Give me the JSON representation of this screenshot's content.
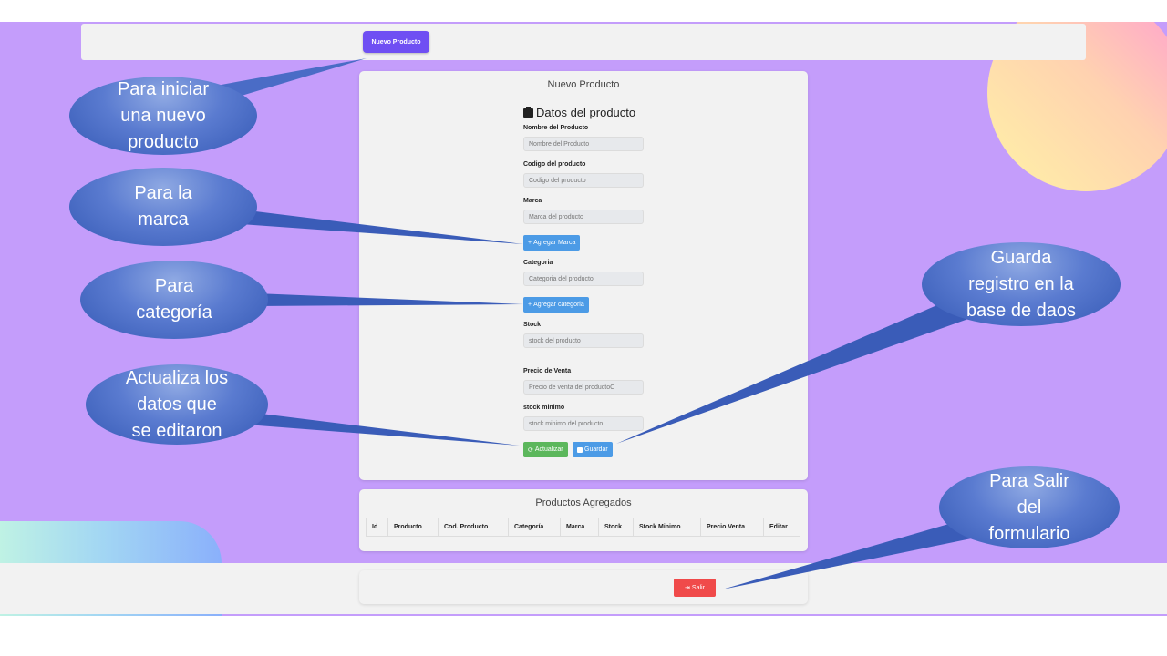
{
  "toolbar": {
    "new_product_label": "Nuevo Producto"
  },
  "form": {
    "title": "Nuevo Producto",
    "section_title": "Datos del producto",
    "fields": [
      {
        "label": "Nombre del Producto",
        "placeholder": "Nombre del Producto"
      },
      {
        "label": "Codigo del producto",
        "placeholder": "Codigo del producto"
      },
      {
        "label": "Marca",
        "placeholder": "Marca del producto"
      },
      {
        "label": "Categoria",
        "placeholder": "Categoria del producto"
      },
      {
        "label": "Stock",
        "placeholder": "stock del producto"
      },
      {
        "label": "Precio de Venta",
        "placeholder": "Precio de venta del productoC"
      },
      {
        "label": "stock minimo",
        "placeholder": "stock minimo del producto"
      }
    ],
    "add_brand_label": "Agregar Marca",
    "add_category_label": "Agregar categoria",
    "update_label": "Actualizar",
    "save_label": "Guardar"
  },
  "products": {
    "title": "Productos Agregados",
    "columns": [
      "Id",
      "Producto",
      "Cod. Producto",
      "Categoría",
      "Marca",
      "Stock",
      "Stock Minimo",
      "Precio Venta",
      "Editar"
    ]
  },
  "exit_label": "Salir",
  "annotations": {
    "new": "Para iniciar\nuna nuevo\nproducto",
    "brand": "Para la\nmarca",
    "category": "Para\ncategoría",
    "update": "Actualiza los\ndatos que\nse editaron",
    "save": "Guarda\nregistro en la\nbase de daos",
    "exit": "Para Salir\ndel\nformulario"
  },
  "colors": {
    "background": "#c49dfb",
    "primary": "#6f4ff3",
    "info": "#4c9be6",
    "success": "#5cb75c",
    "danger": "#f04a4a",
    "callout": "#4a6cc6"
  },
  "icons": {
    "section": "box-icon",
    "add": "plus-icon",
    "update": "refresh-icon",
    "save": "floppy-icon",
    "exit": "sign-out-icon"
  }
}
